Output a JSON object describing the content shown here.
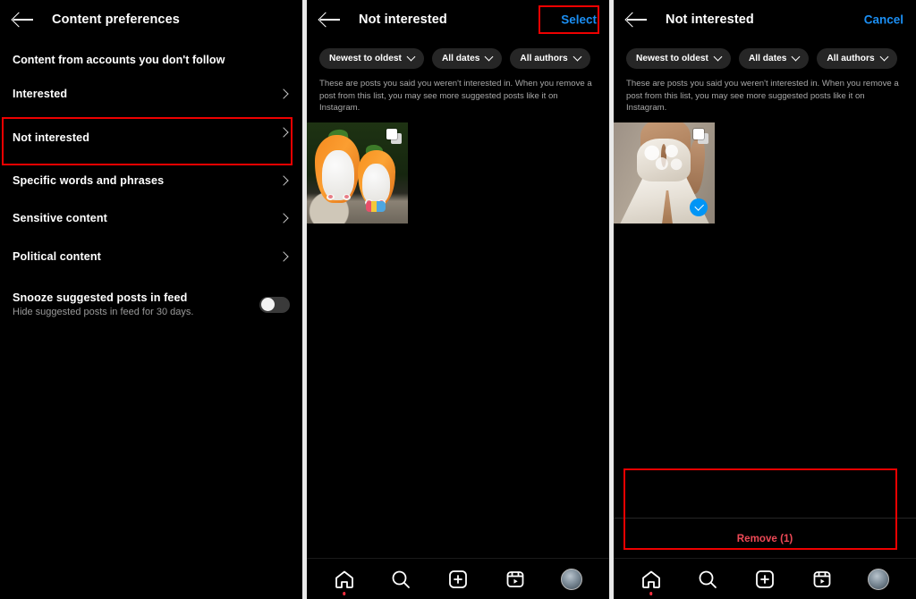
{
  "app": {
    "name": "Instagram",
    "theme": "dark",
    "accent": "#0095F6",
    "danger": "#ED4956",
    "annotation_color": "#EE0000"
  },
  "panel1": {
    "header": {
      "title": "Content preferences",
      "back_icon": "arrow-left-icon"
    },
    "section_label": "Content from accounts you don't follow",
    "rows": [
      {
        "label": "Interested",
        "chevron": "chevron-right-icon"
      },
      {
        "label": "Not interested",
        "chevron": "chevron-right-icon",
        "highlighted": true
      },
      {
        "label": "Specific words and phrases",
        "chevron": "chevron-right-icon"
      },
      {
        "label": "Sensitive content",
        "chevron": "chevron-right-icon"
      },
      {
        "label": "Political content",
        "chevron": "chevron-right-icon"
      }
    ],
    "snooze": {
      "title": "Snooze suggested posts in feed",
      "subtitle": "Hide suggested posts in feed for 30 days.",
      "toggle_state": "off"
    }
  },
  "panel2": {
    "header": {
      "title": "Not interested",
      "action": "Select",
      "back_icon": "arrow-left-icon"
    },
    "filters": [
      {
        "label": "Newest to oldest",
        "icon": "chevron-down-icon"
      },
      {
        "label": "All dates",
        "icon": "chevron-down-icon"
      },
      {
        "label": "All authors",
        "icon": "chevron-down-icon"
      }
    ],
    "description": "These are posts you said you weren't interested in. When you remove a post from this list, you may see more suggested posts like it on Instagram.",
    "post": {
      "alt": "Bunny plush toys in orange carrot costumes",
      "badge_icon": "multi-post-icon",
      "selected": false
    }
  },
  "panel3": {
    "header": {
      "title": "Not interested",
      "action": "Cancel",
      "back_icon": "arrow-left-icon"
    },
    "filters": [
      {
        "label": "Newest to oldest",
        "icon": "chevron-down-icon"
      },
      {
        "label": "All dates",
        "icon": "chevron-down-icon"
      },
      {
        "label": "All authors",
        "icon": "chevron-down-icon"
      }
    ],
    "description": "These are posts you said you weren't interested in. When you remove a post from this list, you may see more suggested posts like it on Instagram.",
    "post": {
      "alt": "White lace wedding dress",
      "badge_icon": "multi-post-icon",
      "selected": true,
      "check_icon": "check-circle-icon"
    },
    "remove_button": {
      "label": "Remove (1)",
      "count": 1
    }
  },
  "navbar": {
    "items": [
      {
        "name": "home",
        "icon": "home-icon",
        "badge": true
      },
      {
        "name": "search",
        "icon": "search-icon",
        "badge": false
      },
      {
        "name": "create",
        "icon": "plus-square-icon",
        "badge": false
      },
      {
        "name": "reels",
        "icon": "reels-icon",
        "badge": false
      },
      {
        "name": "profile",
        "icon": "avatar-icon",
        "badge": false
      }
    ]
  }
}
